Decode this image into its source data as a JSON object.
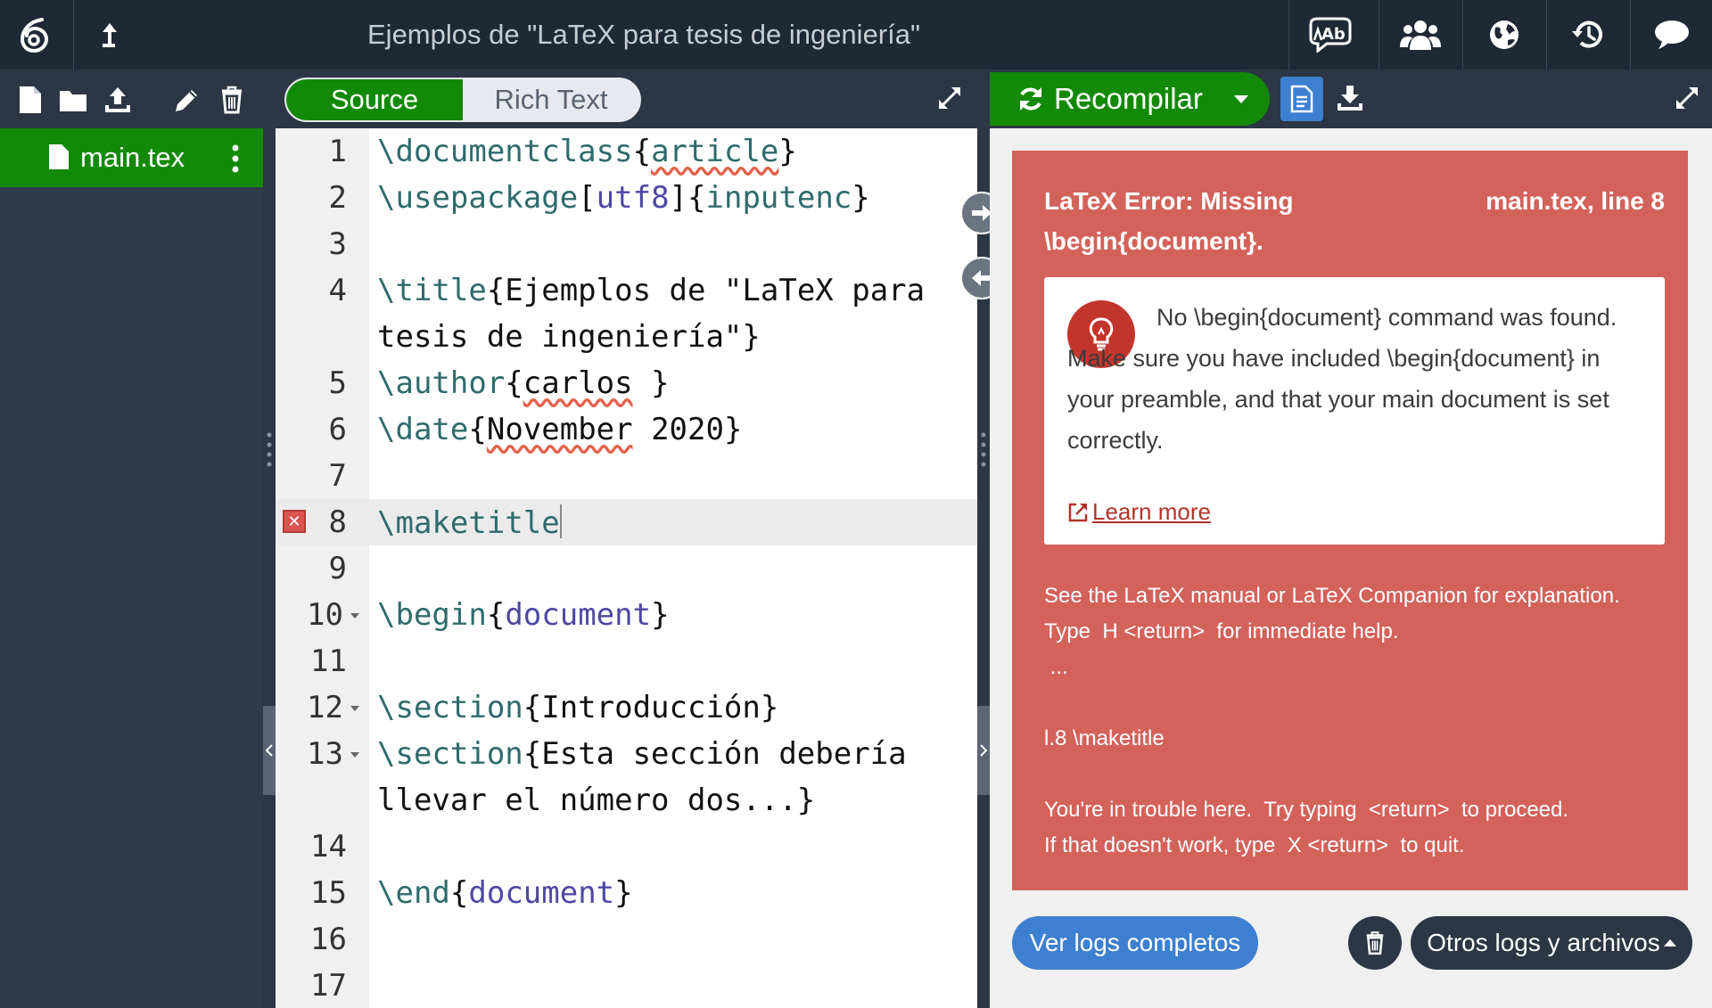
{
  "header": {
    "title": "Ejemplos de \"LaTeX para tesis de ingeniería\""
  },
  "file_tree": {
    "active_file": "main.tex"
  },
  "editor": {
    "toggle": {
      "source": "Source",
      "rich_text": "Rich Text"
    },
    "lines": [
      {
        "n": "1"
      },
      {
        "n": "2"
      },
      {
        "n": "3"
      },
      {
        "n": "4"
      },
      {
        "n": ""
      },
      {
        "n": "5"
      },
      {
        "n": "6"
      },
      {
        "n": "7"
      },
      {
        "n": "8"
      },
      {
        "n": "9"
      },
      {
        "n": "10"
      },
      {
        "n": "11"
      },
      {
        "n": "12"
      },
      {
        "n": "13"
      },
      {
        "n": ""
      },
      {
        "n": "14"
      },
      {
        "n": "15"
      },
      {
        "n": "16"
      },
      {
        "n": "17"
      }
    ],
    "code": {
      "l1_cmd": "\\documentclass",
      "l1_open": "{",
      "l1_arg": "article",
      "l1_close": "}",
      "l2_cmd": "\\usepackage",
      "l2_o1": "[",
      "l2_a1": "utf8",
      "l2_c1": "]",
      "l2_o2": "{",
      "l2_a2": "inputenc",
      "l2_c2": "}",
      "l4_cmd": "\\title",
      "l4_text": "{Ejemplos de \"LaTeX para",
      "l4b_text": "tesis de ingeniería\"}",
      "l5_cmd": "\\author",
      "l5_open": "{",
      "l5_arg": "carlos",
      "l5_close": " }",
      "l6_cmd": "\\date",
      "l6_open": "{",
      "l6_arg": "November",
      "l6_rest": " 2020}",
      "l8_cmd": "\\maketitle",
      "l10_cmd": "\\begin",
      "l10_open": "{",
      "l10_arg": "document",
      "l10_close": "}",
      "l12_cmd": "\\section",
      "l12_text": "{Introducción}",
      "l13_cmd": "\\section",
      "l13_text": "{Esta sección debería",
      "l13b_text": "llevar el número dos...}",
      "l15_cmd": "\\end",
      "l15_open": "{",
      "l15_arg": "document",
      "l15_close": "}"
    }
  },
  "pdf_panel": {
    "recompile_label": "Recompilar"
  },
  "error": {
    "title": "LaTeX Error: Missing \\begin{document}.",
    "location": "main.tex, line 8",
    "hint": "No \\begin{document} command was found. Make sure you have included \\begin{document} in your preamble, and that your main document is set correctly.",
    "learn_more": "Learn more",
    "raw_log": "See the LaTeX manual or LaTeX Companion for explanation.\nType  H <return>  for immediate help.\n ...\n\nl.8 \\maketitle\n\nYou're in trouble here.  Try typing  <return>  to proceed.\nIf that doesn't work, type  X <return>  to quit."
  },
  "footer": {
    "full_logs": "Ver logs completos",
    "other_logs": "Otros logs y archivos"
  }
}
